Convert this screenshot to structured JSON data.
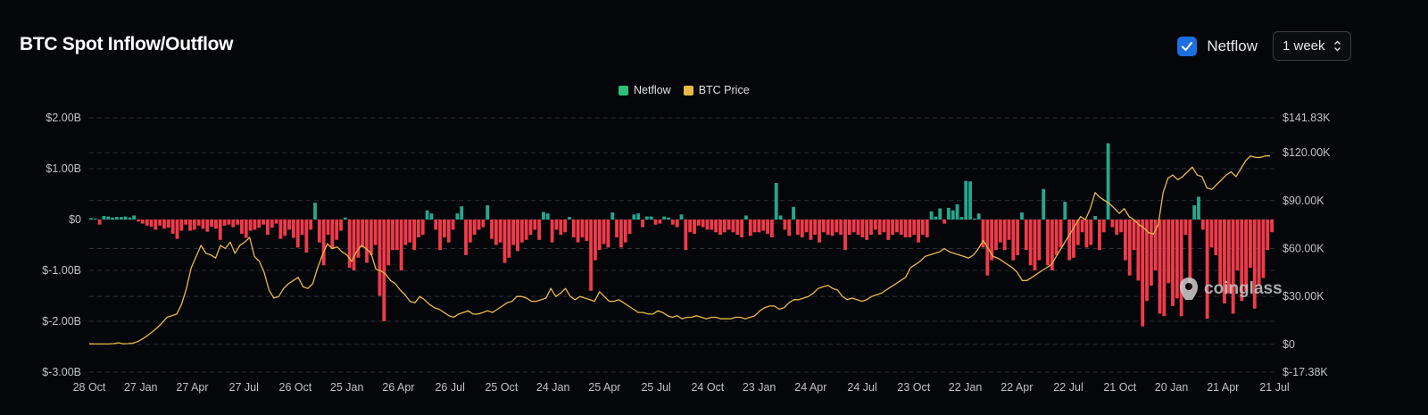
{
  "header": {
    "title": "BTC Spot Inflow/Outflow"
  },
  "controls": {
    "netflow_checked": true,
    "netflow_label": "Netflow",
    "period_value": "1 week"
  },
  "legend": [
    {
      "label": "Netflow",
      "color": "#2fbf7a"
    },
    {
      "label": "BTC Price",
      "color": "#e9b949"
    }
  ],
  "watermark": {
    "text": "coinglass"
  },
  "colors": {
    "inflow": "#25a78c",
    "outflow": "#ef3b4a",
    "price": "#e9b949",
    "grid": "#2c2f36"
  },
  "chart_data": {
    "type": "bar+line",
    "x_ticks": [
      "28 Oct",
      "27 Jan",
      "27 Apr",
      "27 Jul",
      "26 Oct",
      "25 Jan",
      "26 Apr",
      "26 Jul",
      "25 Oct",
      "24 Jan",
      "25 Apr",
      "25 Jul",
      "24 Oct",
      "23 Jan",
      "24 Apr",
      "24 Jul",
      "23 Oct",
      "22 Jan",
      "22 Apr",
      "22 Jul",
      "21 Oct",
      "20 Jan",
      "21 Apr",
      "21 Jul"
    ],
    "left_axis": {
      "ticks": [
        "$2.00B",
        "$1.00B",
        "$0",
        "$-1.00B",
        "$-2.00B",
        "$-3.00B"
      ],
      "range": [
        -3.0,
        2.0
      ],
      "unit": "USD billions"
    },
    "right_axis": {
      "ticks": [
        "$141.83K",
        "$120.00K",
        "$90.00K",
        "$60.00K",
        "$30.00K",
        "$0",
        "$-17.38K"
      ],
      "range": [
        -17.38,
        141.83
      ],
      "unit": "USD thousands"
    },
    "grid": true,
    "legend_position": "top-center",
    "series": [
      {
        "name": "Netflow",
        "type": "bar",
        "axis": "left",
        "values": [
          0.03,
          0.02,
          -0.1,
          0.07,
          0.06,
          0.04,
          0.05,
          0.05,
          0.06,
          0.04,
          0.08,
          -0.04,
          -0.08,
          -0.12,
          -0.14,
          -0.2,
          -0.12,
          -0.18,
          -0.16,
          -0.28,
          -0.38,
          -0.22,
          -0.1,
          -0.22,
          -0.2,
          -0.12,
          -0.18,
          -0.24,
          -0.14,
          -0.18,
          -0.4,
          -0.12,
          -0.1,
          -0.15,
          -0.1,
          -0.28,
          -0.36,
          -0.22,
          -0.2,
          -0.16,
          -0.1,
          -0.3,
          -0.16,
          -0.08,
          -0.38,
          -0.32,
          -0.2,
          -0.36,
          -0.55,
          -0.3,
          -0.65,
          -0.2,
          0.33,
          -0.45,
          -0.9,
          -0.3,
          -0.58,
          -0.4,
          -0.22,
          0.04,
          -0.95,
          -1.0,
          -0.75,
          -0.55,
          -0.85,
          -0.7,
          -0.5,
          -1.5,
          -2.0,
          -0.9,
          -0.6,
          -0.6,
          -1.0,
          -0.5,
          -0.45,
          -0.6,
          -0.35,
          -0.3,
          0.18,
          0.12,
          -0.2,
          -0.6,
          -0.35,
          -0.45,
          -0.2,
          0.12,
          0.26,
          -0.7,
          -0.45,
          -0.3,
          -0.2,
          -0.15,
          0.28,
          -0.38,
          -0.5,
          -0.45,
          -0.85,
          -0.75,
          -0.5,
          -0.62,
          -0.45,
          -0.4,
          -0.3,
          -0.2,
          -0.4,
          0.15,
          0.12,
          -0.45,
          -0.2,
          -0.3,
          -0.25,
          0.05,
          -0.35,
          -0.45,
          -0.35,
          -0.42,
          -1.4,
          -0.8,
          -0.6,
          -0.48,
          -0.55,
          0.14,
          -0.35,
          -0.55,
          -0.45,
          -0.28,
          0.1,
          0.12,
          -0.15,
          0.06,
          0.06,
          -0.1,
          -0.08,
          0.06,
          0.04,
          -0.1,
          -0.15,
          0.1,
          -0.6,
          -0.25,
          -0.28,
          -0.12,
          -0.15,
          -0.2,
          -0.2,
          -0.25,
          -0.3,
          -0.25,
          -0.2,
          -0.25,
          -0.3,
          -0.35,
          0.08,
          -0.32,
          -0.25,
          -0.25,
          -0.22,
          -0.28,
          -0.35,
          0.72,
          0.08,
          -0.2,
          -0.32,
          0.25,
          -0.3,
          -0.35,
          -0.25,
          -0.4,
          -0.3,
          -0.45,
          -0.25,
          -0.3,
          -0.32,
          -0.25,
          -0.3,
          -0.6,
          -0.3,
          -0.25,
          -0.3,
          -0.35,
          -0.4,
          -0.3,
          -0.2,
          -0.3,
          -0.25,
          -0.4,
          -0.3,
          -0.25,
          -0.3,
          -0.35,
          -0.35,
          -0.3,
          -0.45,
          -0.3,
          -0.35,
          0.16,
          0.06,
          0.22,
          -0.08,
          0.23,
          0.18,
          0.3,
          0.05,
          0.76,
          0.75,
          0.02,
          0.12,
          -0.55,
          -1.1,
          -0.8,
          -0.6,
          -0.45,
          -0.6,
          -0.4,
          -0.8,
          -0.7,
          0.14,
          -0.6,
          -0.9,
          -1.0,
          -0.8,
          0.6,
          -0.9,
          -1.0,
          -0.7,
          -0.55,
          0.35,
          -0.8,
          -0.75,
          -0.5,
          -0.25,
          -0.55,
          -0.5,
          0.07,
          -0.6,
          -0.25,
          1.5,
          -0.15,
          -0.3,
          -0.25,
          -0.8,
          -1.1,
          -0.6,
          -1.2,
          -2.1,
          -1.6,
          -1.3,
          -1.0,
          -1.85,
          -1.9,
          -1.25,
          -1.7,
          -1.55,
          -1.9,
          -0.3,
          -1.4,
          0.28,
          0.45,
          -0.2,
          -1.95,
          -0.55,
          -0.7,
          -1.3,
          -1.65,
          -1.45,
          -1.85,
          -1.0,
          -1.6,
          -1.4,
          -0.95,
          -1.75,
          -1.3,
          -1.15,
          -0.6,
          -0.25
        ]
      },
      {
        "name": "BTC Price",
        "type": "line",
        "axis": "right",
        "values": [
          0.4,
          0.3,
          0.3,
          0.3,
          0.25,
          0.5,
          1.0,
          0.4,
          0.5,
          0.8,
          1.8,
          3.5,
          5.5,
          8,
          10.5,
          13.5,
          17,
          18,
          19,
          25,
          35,
          48,
          55,
          62,
          57,
          56,
          54,
          62,
          60,
          64,
          57,
          62,
          64,
          67,
          55,
          52,
          45,
          34,
          29,
          30,
          35,
          38,
          40,
          42,
          36,
          35,
          38,
          48,
          56,
          63,
          60,
          61,
          58,
          56,
          52,
          58,
          62,
          60,
          57,
          47,
          46,
          44,
          40,
          38,
          34,
          31,
          27,
          26,
          30,
          28,
          25,
          23,
          22,
          20,
          18,
          17,
          19,
          20,
          21,
          19,
          19,
          20,
          21,
          20,
          22,
          24,
          26,
          27,
          30,
          30,
          29,
          27,
          27,
          28,
          29,
          35,
          30,
          32,
          35,
          30,
          28,
          30,
          29,
          28,
          27,
          33,
          30,
          27,
          27,
          28,
          26,
          24,
          22,
          20,
          20,
          19,
          19,
          21,
          20,
          18,
          17,
          18,
          16,
          17,
          17,
          18,
          17,
          16,
          17,
          17,
          16,
          16,
          16,
          17,
          17,
          16,
          17,
          18,
          21,
          23,
          24,
          24,
          22,
          23,
          26,
          28,
          28,
          29,
          30,
          32,
          35,
          36,
          37,
          35,
          34,
          30,
          28,
          29,
          28,
          27,
          28,
          30,
          31,
          32,
          34,
          36,
          38,
          40,
          42,
          48,
          50,
          52,
          55,
          56,
          57,
          58,
          60,
          58,
          57,
          56,
          55,
          54,
          56,
          60,
          65,
          60,
          55,
          54,
          52,
          50,
          48,
          45,
          40,
          40,
          42,
          44,
          46,
          48,
          50,
          55,
          60,
          65,
          70,
          75,
          80,
          78,
          85,
          95,
          92,
          90,
          88,
          85,
          82,
          85,
          80,
          78,
          75,
          73,
          70,
          69,
          75,
          95,
          104,
          106,
          103,
          105,
          108,
          111,
          106,
          105,
          98,
          97,
          100,
          103,
          106,
          108,
          105,
          110,
          115,
          118,
          117,
          117,
          118,
          118
        ]
      }
    ]
  }
}
